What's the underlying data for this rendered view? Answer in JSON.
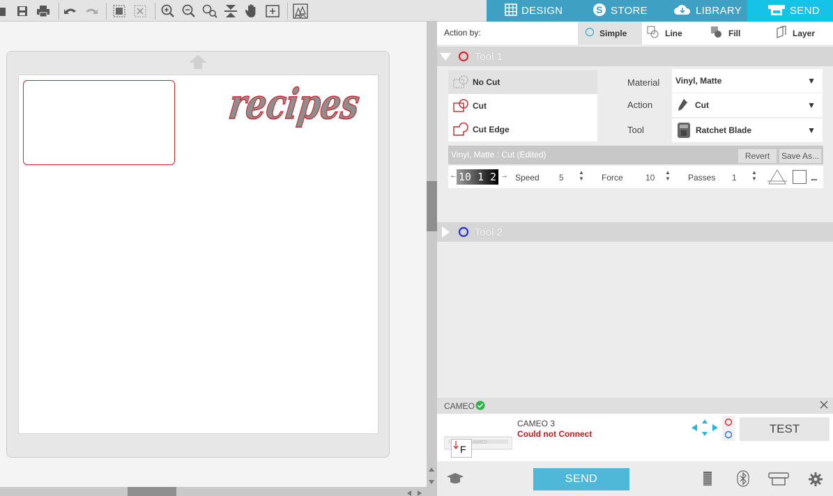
{
  "top_nav": {
    "tabs": [
      {
        "label": "DESIGN",
        "icon": "grid-icon",
        "active": false
      },
      {
        "label": "STORE",
        "icon": "store-s-icon",
        "active": false
      },
      {
        "label": "LIBRARY",
        "icon": "cloud-icon",
        "active": false
      },
      {
        "label": "SEND",
        "icon": "cutter-icon",
        "active": true
      }
    ]
  },
  "toolbar": {
    "icons": [
      "open-icon",
      "save-icon",
      "print-icon",
      "undo-icon",
      "redo-icon",
      "select-all-icon",
      "deselect-icon",
      "zoom-in-icon",
      "zoom-out-icon",
      "zoom-select-icon",
      "fit-to-page-icon",
      "pan-hand-icon",
      "add-page-icon",
      "pixscan-icon"
    ]
  },
  "canvas": {
    "design_text": "recipes",
    "colors": {
      "cut_line": "#d0242b",
      "text_fill": "#8e8e8e"
    }
  },
  "panel": {
    "action_by": {
      "label": "Action by:",
      "options": [
        {
          "label": "Simple",
          "selected": true
        },
        {
          "label": "Line",
          "selected": false
        },
        {
          "label": "Fill",
          "selected": false
        },
        {
          "label": "Layer",
          "selected": false
        }
      ]
    },
    "tool1": {
      "label": "Tool 1",
      "color": "#e0242b",
      "cut_options": [
        {
          "label": "No Cut",
          "selected": true
        },
        {
          "label": "Cut",
          "selected": false
        },
        {
          "label": "Cut Edge",
          "selected": false
        }
      ],
      "material_label": "Material",
      "material_value": "Vinyl, Matte",
      "action_label": "Action",
      "action_value": "Cut",
      "tool_label": "Tool",
      "tool_value": "Ratchet Blade",
      "summary": "Vinyl, Matte : Cut (Edited)",
      "revert_label": "Revert",
      "save_as_label": "Save As...",
      "blade_digits": "10 1 2",
      "speed_label": "Speed",
      "speed_value": "5",
      "force_label": "Force",
      "force_value": "10",
      "passes_label": "Passes",
      "passes_value": "1",
      "more_label": "..."
    },
    "tool2": {
      "label": "Tool 2",
      "color": "#2431d6"
    },
    "device": {
      "name_label": "CAMEO",
      "model": "CAMEO 3",
      "status": "Could not Connect",
      "status_color": "#c8161d",
      "machine_label": "CAMEO",
      "preview_letter": "F",
      "test_label": "TEST",
      "send_label": "SEND"
    }
  }
}
